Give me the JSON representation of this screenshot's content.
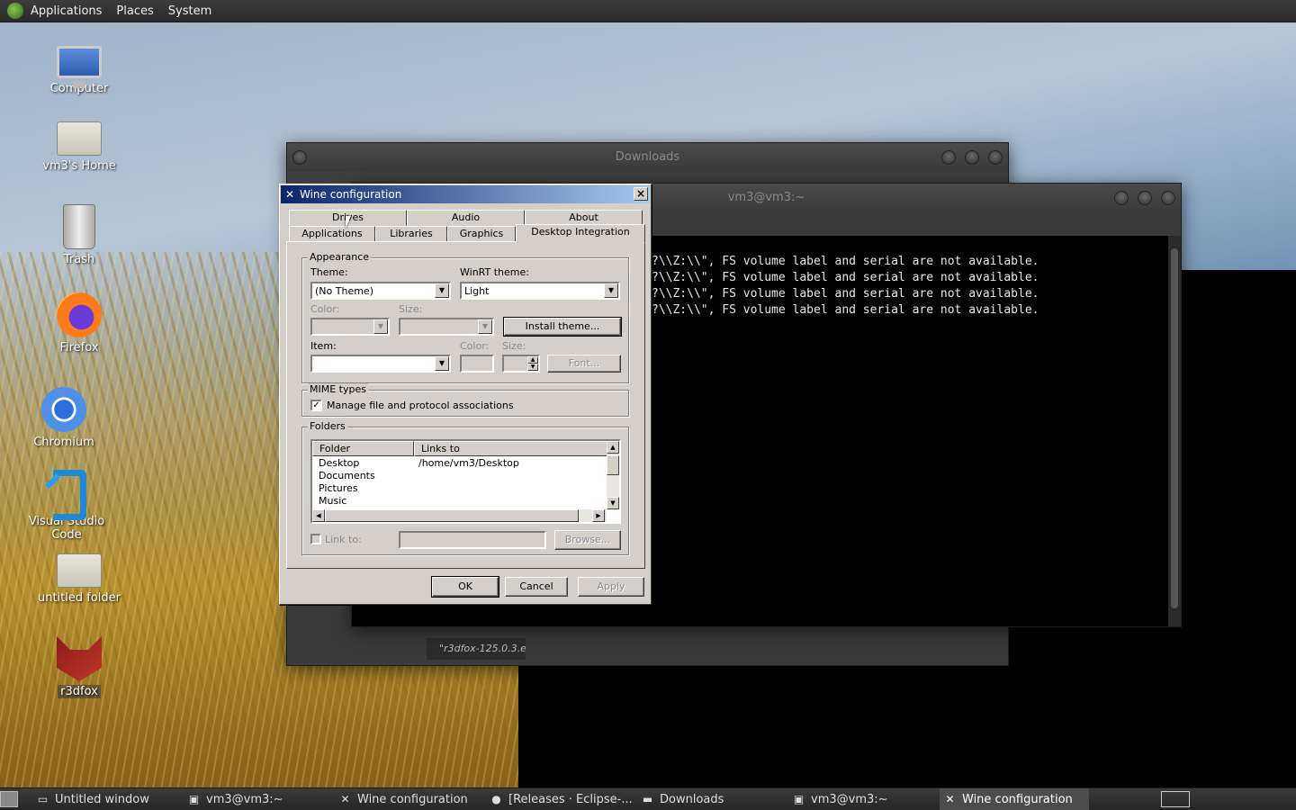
{
  "top_panel": {
    "menus": [
      "Applications",
      "Places",
      "System"
    ]
  },
  "desktop_icons": [
    {
      "label": "Computer",
      "icon": "computer-icon"
    },
    {
      "label": "vm3's Home",
      "icon": "home-folder-icon"
    },
    {
      "label": "Trash",
      "icon": "trash-icon"
    },
    {
      "label": "Firefox",
      "icon": "firefox-icon"
    },
    {
      "label": "Chromium",
      "icon": "chromium-icon"
    },
    {
      "label": "Visual Studio Code",
      "icon": "vscode-icon"
    },
    {
      "label": "untitled folder",
      "icon": "folder-icon"
    },
    {
      "label": "r3dfox",
      "icon": "r3dfox-icon"
    }
  ],
  "downloads_window": {
    "title": "Downloads",
    "status_text": "\"r3dfox-125.0.3.e"
  },
  "terminal_window": {
    "title": "vm3@vm3:~",
    "lines": [
      "?\\\\Z:\\\\\", FS volume label and serial are not available.",
      "?\\\\Z:\\\\\", FS volume label and serial are not available.",
      "?\\\\Z:\\\\\", FS volume label and serial are not available.",
      "?\\\\Z:\\\\\", FS volume label and serial are not available."
    ]
  },
  "wine_dialog": {
    "title": "Wine configuration",
    "tabs_row1": [
      "Drives",
      "Audio",
      "About"
    ],
    "tabs_row2": [
      "Applications",
      "Libraries",
      "Graphics",
      "Desktop Integration"
    ],
    "active_tab": "Desktop Integration",
    "appearance": {
      "group_title": "Appearance",
      "theme_label": "Theme:",
      "theme_value": "(No Theme)",
      "winrt_label": "WinRT theme:",
      "winrt_value": "Light",
      "color_label": "Color:",
      "size_label": "Size:",
      "install_theme_button": "Install theme...",
      "item_label": "Item:",
      "item_color_label": "Color:",
      "item_size_label": "Size:",
      "font_button": "Font..."
    },
    "mime": {
      "group_title": "MIME types",
      "checkbox_label": "Manage file and protocol associations",
      "checked": true
    },
    "folders": {
      "group_title": "Folders",
      "columns": [
        "Folder",
        "Links to"
      ],
      "rows": [
        {
          "folder": "Desktop",
          "link": "/home/vm3/Desktop"
        },
        {
          "folder": "Documents",
          "link": ""
        },
        {
          "folder": "Pictures",
          "link": ""
        },
        {
          "folder": "Music",
          "link": ""
        }
      ],
      "link_to_label": "Link to:",
      "browse_button": "Browse..."
    },
    "buttons": {
      "ok": "OK",
      "cancel": "Cancel",
      "apply": "Apply"
    }
  },
  "taskbar": {
    "tasks": [
      {
        "label": "Untitled window",
        "icon": "window-icon",
        "active": false
      },
      {
        "label": "vm3@vm3:~",
        "icon": "terminal-icon",
        "active": false
      },
      {
        "label": "Wine configuration",
        "icon": "wine-icon",
        "active": false
      },
      {
        "label": "[Releases · Eclipse-...",
        "icon": "firefox-icon",
        "active": false
      },
      {
        "label": "Downloads",
        "icon": "folder-icon",
        "active": false
      },
      {
        "label": "vm3@vm3:~",
        "icon": "terminal-icon",
        "active": false
      },
      {
        "label": "Wine configuration",
        "icon": "wine-icon",
        "active": true
      }
    ]
  }
}
